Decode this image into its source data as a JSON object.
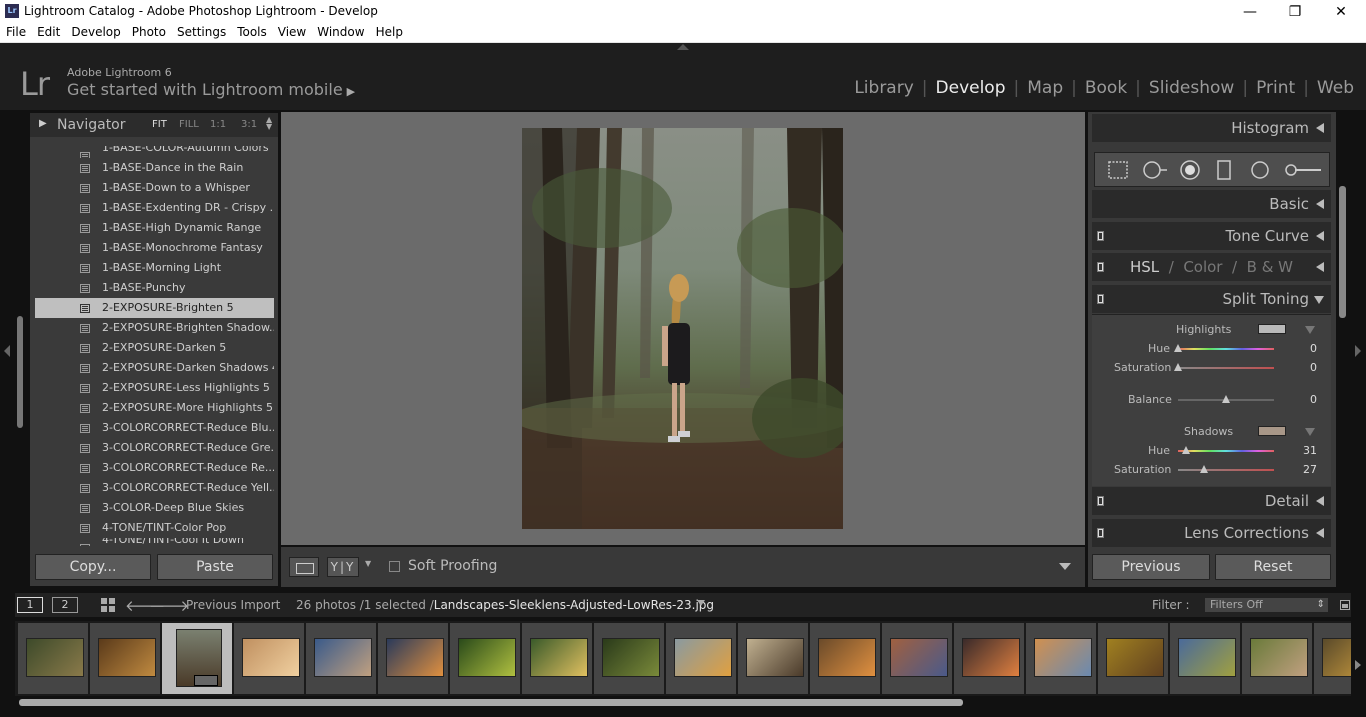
{
  "window": {
    "title": "Lightroom Catalog - Adobe Photoshop Lightroom - Develop",
    "app_icon": "Lr",
    "controls": {
      "minimize": "—",
      "maximize": "❐",
      "close": "✕"
    }
  },
  "menu": [
    "File",
    "Edit",
    "Develop",
    "Photo",
    "Settings",
    "Tools",
    "View",
    "Window",
    "Help"
  ],
  "identity": {
    "logo": "Lr",
    "product": "Adobe Lightroom 6",
    "mobile_prompt": "Get started with Lightroom mobile",
    "mobile_arrow": "▶",
    "modules": [
      "Library",
      "Develop",
      "Map",
      "Book",
      "Slideshow",
      "Print",
      "Web"
    ],
    "active_module": "Develop",
    "separator": "|"
  },
  "navigator": {
    "title": "Navigator",
    "zoom_options": [
      "FIT",
      "FILL",
      "1:1",
      "3:1"
    ],
    "selected_zoom": "FIT"
  },
  "presets": {
    "items": [
      {
        "label": "1-BASE-COLOR-Autumn Colors",
        "partial": true
      },
      {
        "label": "1-BASE-Dance in the Rain"
      },
      {
        "label": "1-BASE-Down to a Whisper"
      },
      {
        "label": "1-BASE-Exdenting DR - Crispy ..."
      },
      {
        "label": "1-BASE-High Dynamic Range"
      },
      {
        "label": "1-BASE-Monochrome Fantasy"
      },
      {
        "label": "1-BASE-Morning Light"
      },
      {
        "label": "1-BASE-Punchy"
      },
      {
        "label": "2-EXPOSURE-Brighten 5",
        "selected": true
      },
      {
        "label": "2-EXPOSURE-Brighten Shadow..."
      },
      {
        "label": "2-EXPOSURE-Darken 5"
      },
      {
        "label": "2-EXPOSURE-Darken Shadows 4"
      },
      {
        "label": "2-EXPOSURE-Less Highlights 5"
      },
      {
        "label": "2-EXPOSURE-More Highlights 5"
      },
      {
        "label": "3-COLORCORRECT-Reduce Blu..."
      },
      {
        "label": "3-COLORCORRECT-Reduce Gre..."
      },
      {
        "label": "3-COLORCORRECT-Reduce Re..."
      },
      {
        "label": "3-COLORCORRECT-Reduce Yell..."
      },
      {
        "label": "3-COLOR-Deep Blue Skies"
      },
      {
        "label": "4-TONE/TINT-Color Pop"
      },
      {
        "label": "4-TONE/TINT-Cool It Down",
        "partial": true
      }
    ]
  },
  "left_buttons": {
    "copy": "Copy...",
    "paste": "Paste"
  },
  "toolbar": {
    "view_yy": "Y|Y",
    "soft_proofing": "Soft Proofing"
  },
  "right_panel": {
    "histogram": "Histogram",
    "basic": "Basic",
    "tone_curve": "Tone Curve",
    "hsl": {
      "hsl": "HSL",
      "color": "Color",
      "bw": "B & W",
      "sep": "/"
    },
    "split_toning": {
      "title": "Split Toning",
      "highlights_label": "Highlights",
      "highlights_hue_label": "Hue",
      "highlights_hue": "0",
      "highlights_sat_label": "Saturation",
      "highlights_sat": "0",
      "balance_label": "Balance",
      "balance": "0",
      "shadows_label": "Shadows",
      "shadows_hue_label": "Hue",
      "shadows_hue": "31",
      "shadows_sat_label": "Saturation",
      "shadows_sat": "27",
      "highlights_swatch": "#b9b9b9",
      "shadows_swatch": "#a89788"
    },
    "detail": "Detail",
    "lens_corrections": "Lens Corrections",
    "previous": "Previous",
    "reset": "Reset"
  },
  "filmstrip": {
    "screen1": "1",
    "screen2": "2",
    "source": "Previous Import",
    "count": "26 photos /1 selected /",
    "filename": "Landscapes-Sleeklens-Adjusted-LowRes-23.jpg",
    "filter_label": "Filter :",
    "filter_value": "Filters Off"
  }
}
